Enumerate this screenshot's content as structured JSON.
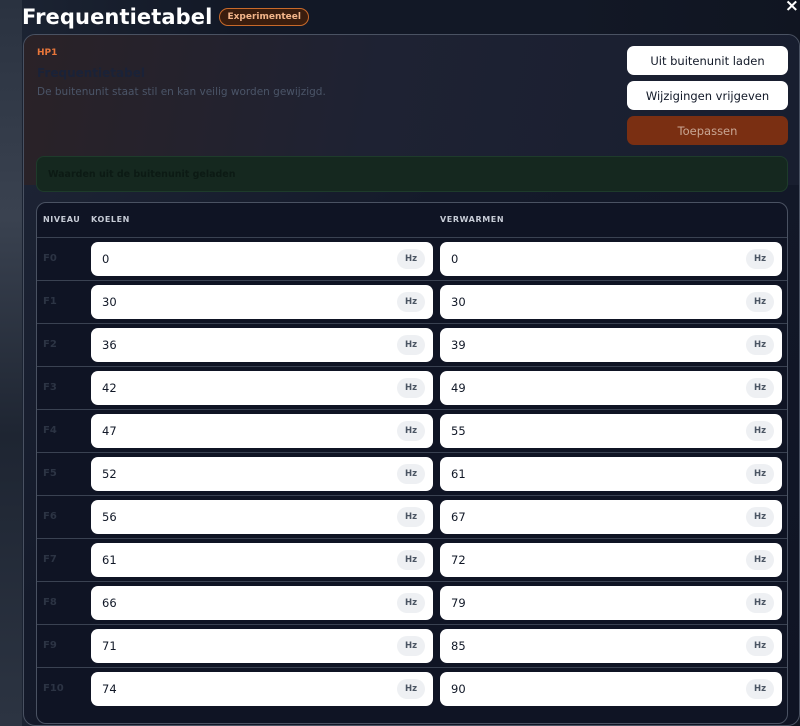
{
  "header": {
    "title": "Frequentietabel",
    "badge": "Experimenteel",
    "close_icon": "×"
  },
  "panel": {
    "unit_label": "HP1",
    "title": "Frequentietabel",
    "subtitle": "De buitenunit staat stil en kan veilig worden gewijzigd.",
    "buttons": {
      "load": "Uit buitenunit laden",
      "release": "Wijzigingen vrijgeven",
      "apply": "Toepassen"
    },
    "notice": "Waarden uit de buitenunit geladen"
  },
  "table": {
    "columns": {
      "level": "NIVEAU",
      "cooling": "KOELEN",
      "heating": "VERWARMEN"
    },
    "unit": "Hz",
    "rows": [
      {
        "level": "F0",
        "cooling": "0",
        "heating": "0"
      },
      {
        "level": "F1",
        "cooling": "30",
        "heating": "30"
      },
      {
        "level": "F2",
        "cooling": "36",
        "heating": "39"
      },
      {
        "level": "F3",
        "cooling": "42",
        "heating": "49"
      },
      {
        "level": "F4",
        "cooling": "47",
        "heating": "55"
      },
      {
        "level": "F5",
        "cooling": "52",
        "heating": "61"
      },
      {
        "level": "F6",
        "cooling": "56",
        "heating": "67"
      },
      {
        "level": "F7",
        "cooling": "61",
        "heating": "72"
      },
      {
        "level": "F8",
        "cooling": "66",
        "heating": "79"
      },
      {
        "level": "F9",
        "cooling": "71",
        "heating": "85"
      },
      {
        "level": "F10",
        "cooling": "74",
        "heating": "90"
      }
    ]
  }
}
